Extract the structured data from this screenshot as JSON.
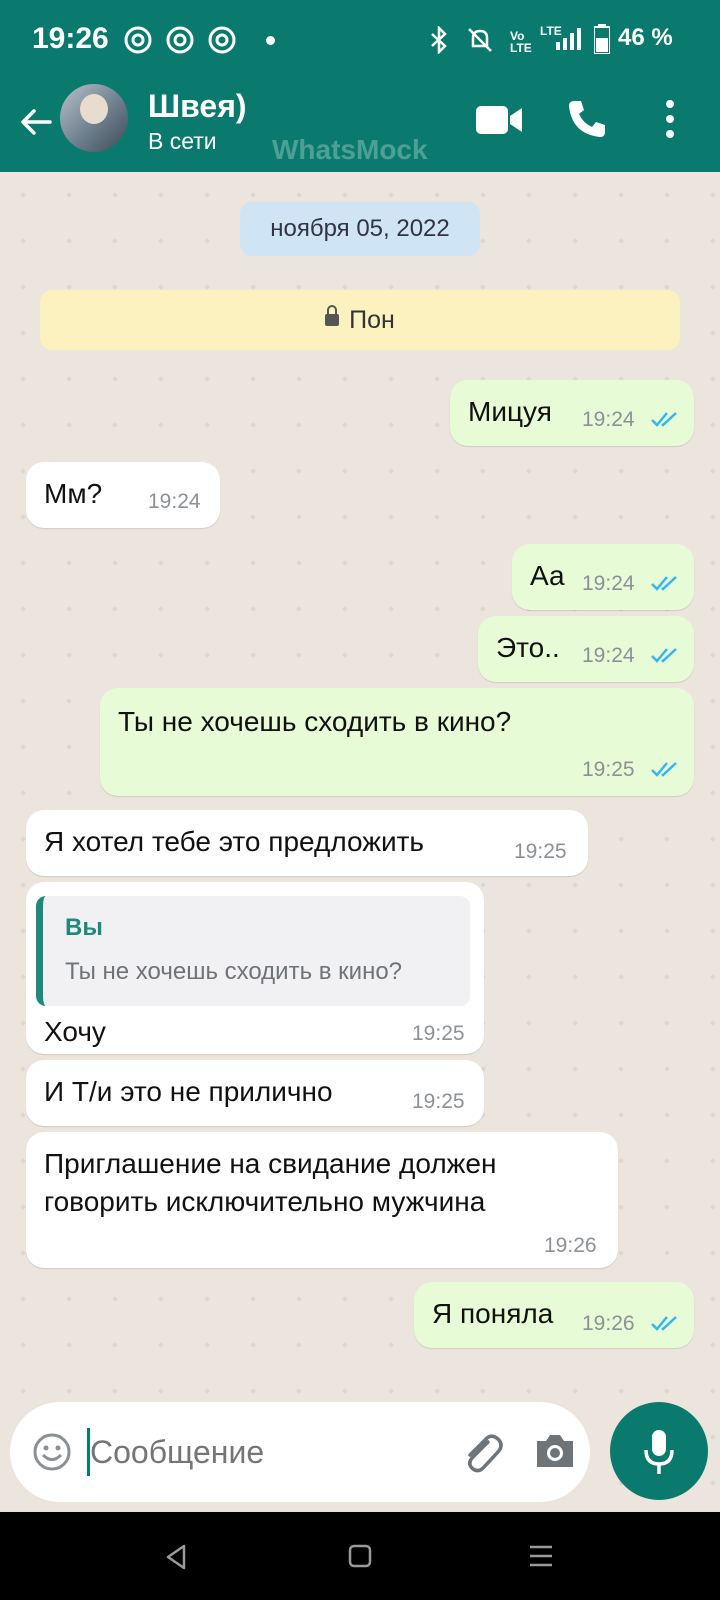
{
  "status_bar": {
    "time": "19:26",
    "battery": "46 %",
    "network": "LTE"
  },
  "header": {
    "contact_name": "Швея)",
    "status": "В сети",
    "watermark": "WhatsMock"
  },
  "chat": {
    "date_chip": "ноября 05, 2022",
    "system_banner": "Пон",
    "messages": [
      {
        "dir": "out",
        "text": "Мицуя",
        "time": "19:24",
        "read": true
      },
      {
        "dir": "in",
        "text": "Мм?",
        "time": "19:24"
      },
      {
        "dir": "out",
        "text": "Аа",
        "time": "19:24",
        "read": true
      },
      {
        "dir": "out",
        "text": "Это..",
        "time": "19:24",
        "read": true
      },
      {
        "dir": "out",
        "text": "Ты не хочешь сходить в кино?",
        "time": "19:25",
        "read": true
      },
      {
        "dir": "in",
        "text": "Я хотел тебе это предложить",
        "time": "19:25"
      },
      {
        "dir": "in",
        "reply_to_author": "Вы",
        "reply_to_text": "Ты не хочешь сходить в кино?",
        "text": "Хочу",
        "time": "19:25"
      },
      {
        "dir": "in",
        "text": "И Т/и это не прилично",
        "time": "19:25"
      },
      {
        "dir": "in",
        "text_line1": "Приглашение на свидание должен",
        "text_line2": "говорить исключительно мужчина",
        "time": "19:26"
      },
      {
        "dir": "out",
        "text": "Я поняла",
        "time": "19:26",
        "read": true
      }
    ]
  },
  "composer": {
    "placeholder": "Сообщение"
  },
  "colors": {
    "brand": "#0b7a6e",
    "outgoing_bubble": "#e7fbd6",
    "incoming_bubble": "#ffffff",
    "read_ticks": "#34b7f1"
  },
  "icons": [
    "back-arrow-icon",
    "video-call-icon",
    "phone-icon",
    "more-options-icon",
    "emoji-icon",
    "attach-icon",
    "camera-icon",
    "mic-icon",
    "nav-back-icon",
    "nav-home-icon",
    "nav-recents-icon"
  ]
}
